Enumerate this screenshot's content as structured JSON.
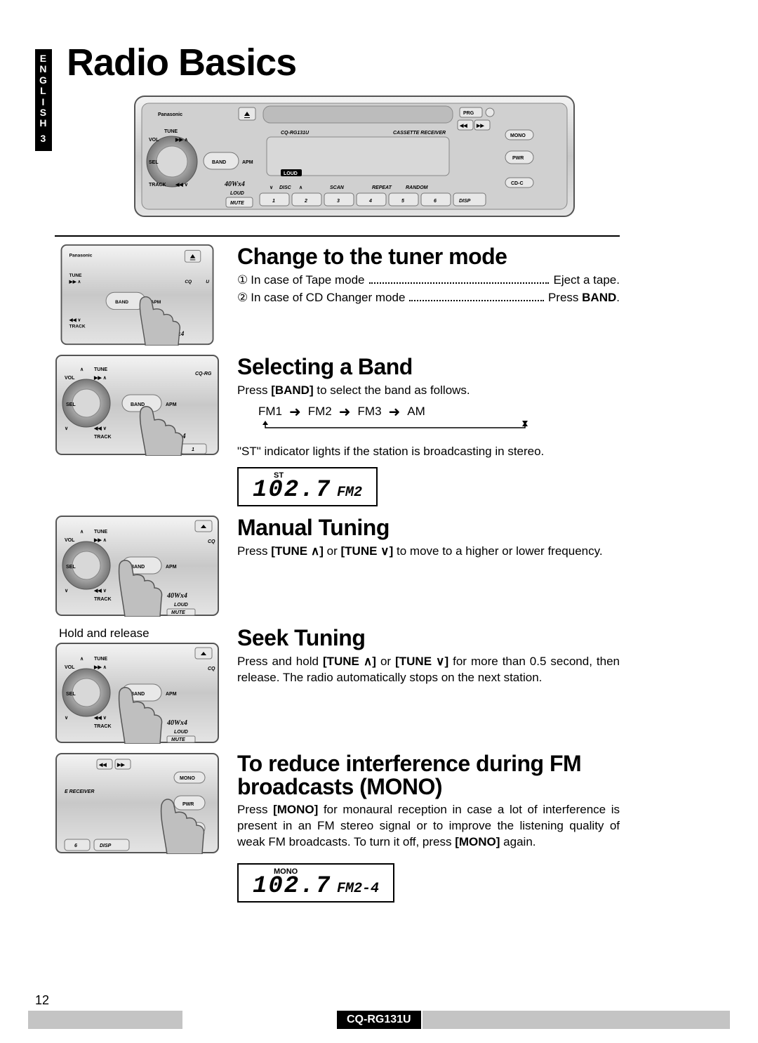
{
  "sidebar": {
    "language": "ENGLISH",
    "page_tab_number": "3"
  },
  "title": "Radio Basics",
  "faceplate": {
    "brand": "Panasonic",
    "model": "CQ-RG131U",
    "labels": {
      "tune": "TUNE",
      "vol": "VOL",
      "sel": "SEL",
      "band": "BAND",
      "apm": "APM",
      "track": "TRACK",
      "power_spec": "40Wx4",
      "loud": "LOUD",
      "mute": "MUTE",
      "scan": "SCAN",
      "repeat": "REPEAT",
      "random": "RANDOM",
      "disc": "DISC",
      "disp": "DISP",
      "cassette": "CASSETTE RECEIVER",
      "prg": "PRG",
      "mono": "MONO",
      "pwr": "PWR",
      "cdc": "CD-C"
    },
    "preset_numbers": [
      "1",
      "2",
      "3",
      "4",
      "5",
      "6"
    ]
  },
  "sections": {
    "change": {
      "heading": "Change to the tuner mode",
      "step1_label": "In case of Tape mode",
      "step1_action": "Eject a tape.",
      "step2_label": "In case of CD Changer mode",
      "step2_action_prefix": "Press ",
      "step2_action_bold": "BAND",
      "step2_action_suffix": "."
    },
    "band": {
      "heading": "Selecting a Band",
      "text_prefix": "Press ",
      "text_bold": "[BAND]",
      "text_suffix": " to select the band as follows.",
      "cycle": [
        "FM1",
        "FM2",
        "FM3",
        "AM"
      ],
      "note": "\"ST\" indicator lights if the station is broadcasting in stereo.",
      "lcd_tag": "ST",
      "lcd_freq": "102.7",
      "lcd_band": "FM2"
    },
    "manual": {
      "heading": "Manual Tuning",
      "text": "Press [TUNE ∧] or [TUNE ∨] to move to a higher or lower frequency."
    },
    "seek": {
      "heading": "Seek Tuning",
      "caption": "Hold and release",
      "text": "Press and hold [TUNE ∧] or [TUNE ∨] for more than 0.5 second, then release. The radio automatically stops on the next station."
    },
    "mono": {
      "heading": "To reduce interference during FM broadcasts (MONO)",
      "text": "Press [MONO] for monaural reception in case a lot of interference is present in an FM stereo signal or to improve the listening quality of weak FM broadcasts. To turn it off, press [MONO] again.",
      "lcd_tag": "MONO",
      "lcd_freq": "102.7",
      "lcd_band": "FM2-4"
    }
  },
  "footer": {
    "page_number": "12",
    "model": "CQ-RG131U"
  }
}
